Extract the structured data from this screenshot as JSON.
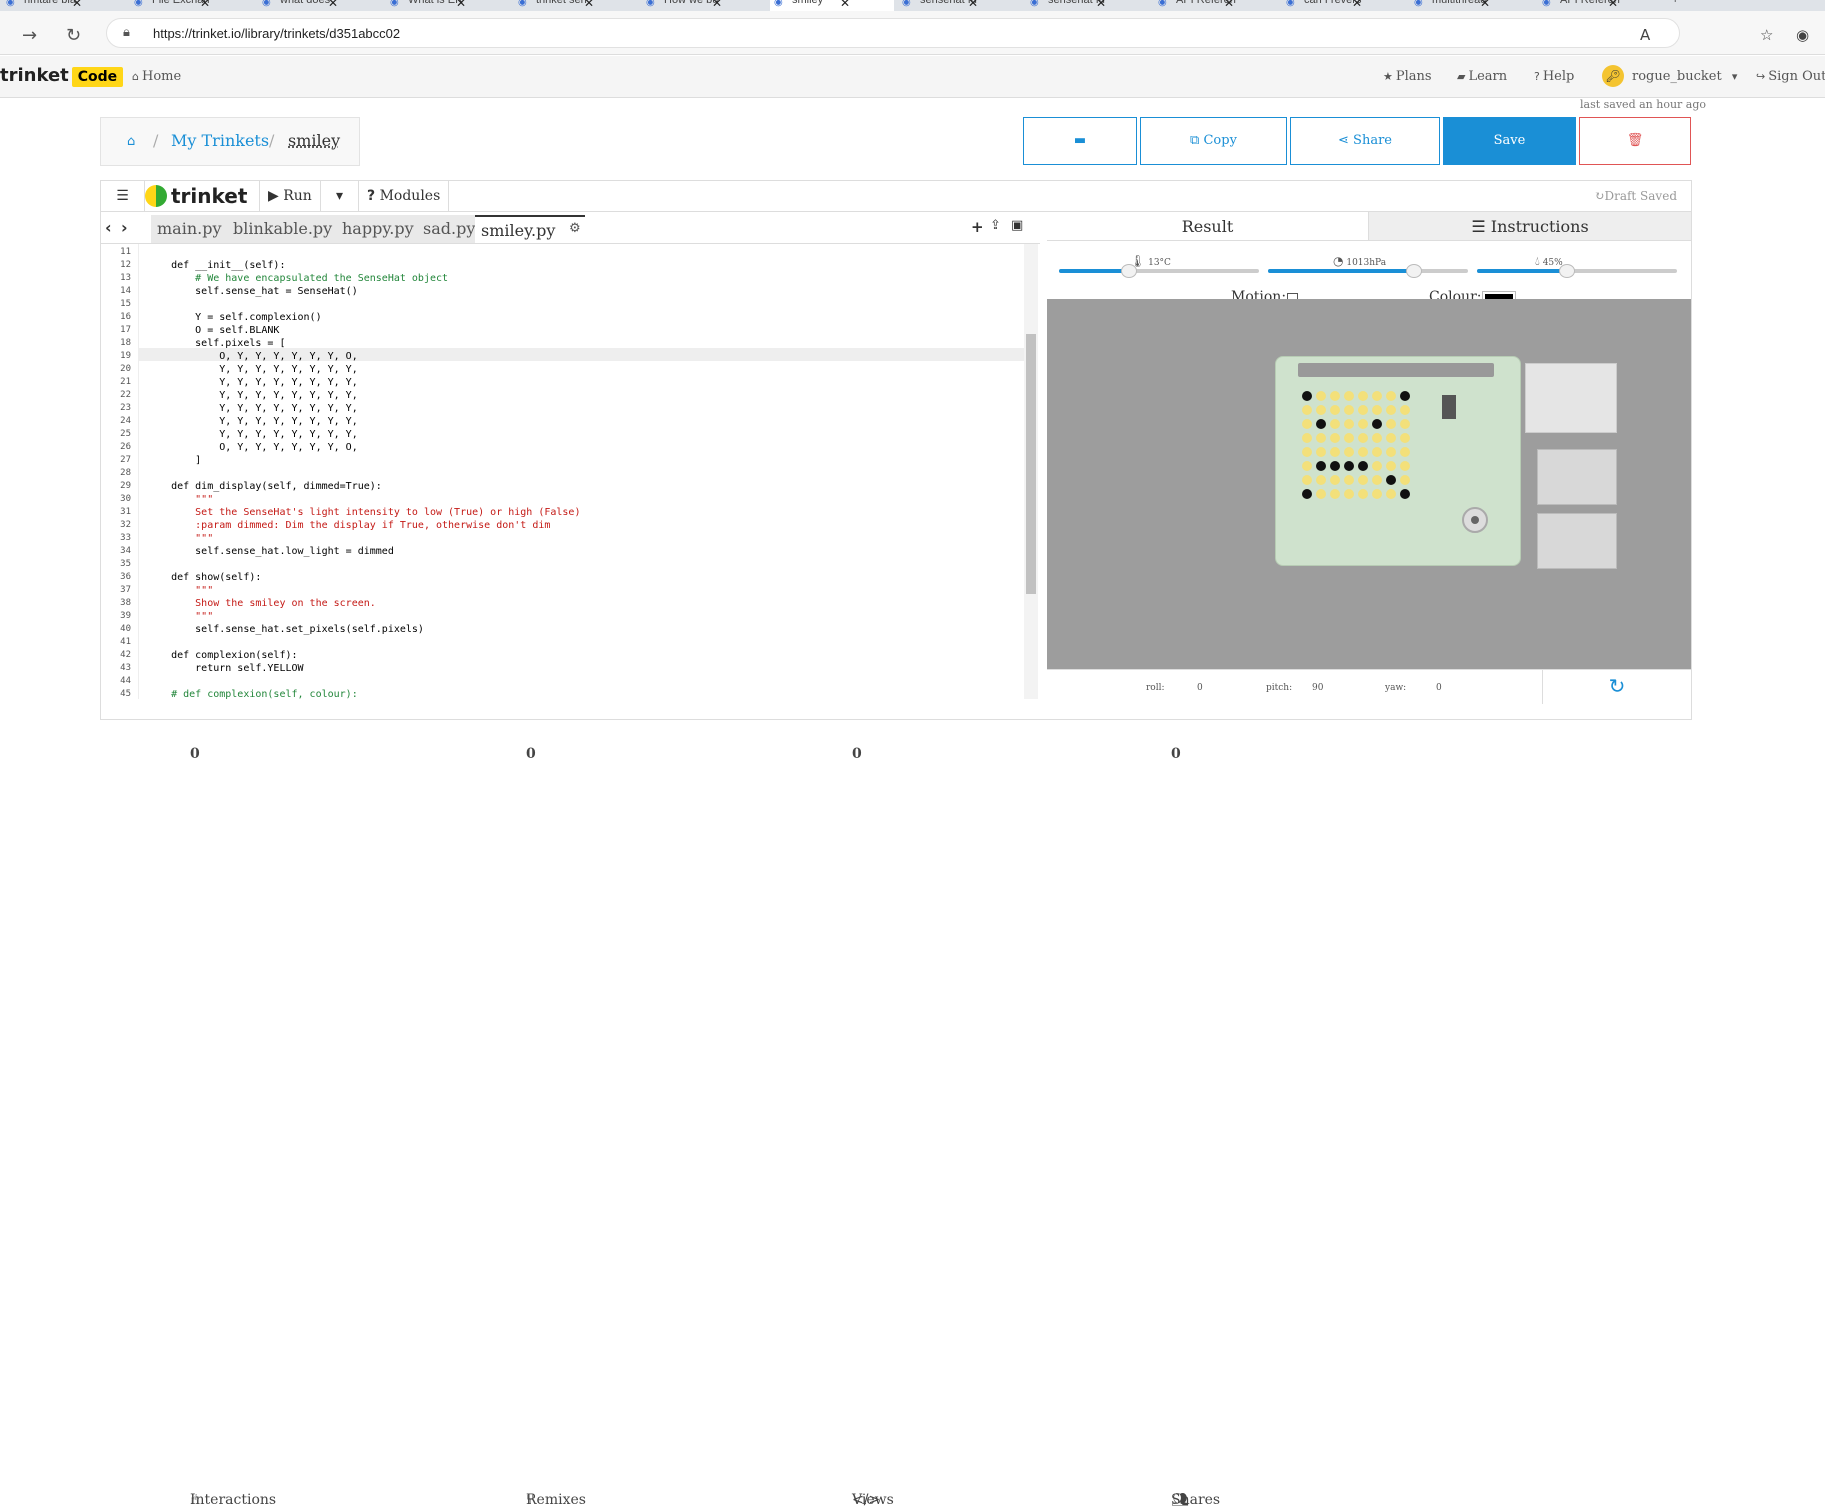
{
  "browser": {
    "tabs": [
      "hmtare bla",
      "File Exchan",
      "what does",
      "What is ER",
      "trinket sen",
      "How we bu",
      "smiley",
      "sensehat fu",
      "sensehat fu",
      "API Referen",
      "can I revers",
      "multithread",
      "API Referen"
    ],
    "active_tab": "smiley",
    "url": "https://trinket.io/library/trinkets/d351abcc02"
  },
  "site": {
    "logo": "trinket",
    "logo_badge": "Code",
    "home": "Home",
    "nav": [
      "Plans",
      "Learn",
      "Help"
    ],
    "user": "rogue_bucket",
    "sign_out": "Sign Out"
  },
  "breadcrumb": {
    "root": "My Trinkets",
    "current": "smiley"
  },
  "last_saved": "last saved an hour ago",
  "actions": {
    "copy": "Copy",
    "share": "Share",
    "save": "Save"
  },
  "toolbar": {
    "logo": "trinket",
    "run": "Run",
    "modules": "Modules",
    "draft": "Draft Saved"
  },
  "files": [
    "main.py",
    "blinkable.py",
    "happy.py",
    "sad.py",
    "smiley.py"
  ],
  "active_file": "smiley.py",
  "code": [
    {
      "n": "11",
      "t": ""
    },
    {
      "n": "12",
      "t": "    def __init__(self):"
    },
    {
      "n": "13",
      "t": "        # We have encapsulated the SenseHat object"
    },
    {
      "n": "14",
      "t": "        self.sense_hat = SenseHat()"
    },
    {
      "n": "15",
      "t": ""
    },
    {
      "n": "16",
      "t": "        Y = self.complexion()"
    },
    {
      "n": "17",
      "t": "        O = self.BLANK"
    },
    {
      "n": "18",
      "t": "        self.pixels = ["
    },
    {
      "n": "19",
      "t": "            O, Y, Y, Y, Y, Y, Y, O,"
    },
    {
      "n": "20",
      "t": "            Y, Y, Y, Y, Y, Y, Y, Y,"
    },
    {
      "n": "21",
      "t": "            Y, Y, Y, Y, Y, Y, Y, Y,"
    },
    {
      "n": "22",
      "t": "            Y, Y, Y, Y, Y, Y, Y, Y,"
    },
    {
      "n": "23",
      "t": "            Y, Y, Y, Y, Y, Y, Y, Y,"
    },
    {
      "n": "24",
      "t": "            Y, Y, Y, Y, Y, Y, Y, Y,"
    },
    {
      "n": "25",
      "t": "            Y, Y, Y, Y, Y, Y, Y, Y,"
    },
    {
      "n": "26",
      "t": "            O, Y, Y, Y, Y, Y, Y, O,"
    },
    {
      "n": "27",
      "t": "        ]"
    },
    {
      "n": "28",
      "t": ""
    },
    {
      "n": "29",
      "t": "    def dim_display(self, dimmed=True):"
    },
    {
      "n": "30",
      "t": "        \"\"\""
    },
    {
      "n": "31",
      "t": "        Set the SenseHat's light intensity to low (True) or high (False)"
    },
    {
      "n": "32",
      "t": "        :param dimmed: Dim the display if True, otherwise don't dim"
    },
    {
      "n": "33",
      "t": "        \"\"\""
    },
    {
      "n": "34",
      "t": "        self.sense_hat.low_light = dimmed"
    },
    {
      "n": "35",
      "t": ""
    },
    {
      "n": "36",
      "t": "    def show(self):"
    },
    {
      "n": "37",
      "t": "        \"\"\""
    },
    {
      "n": "38",
      "t": "        Show the smiley on the screen."
    },
    {
      "n": "39",
      "t": "        \"\"\""
    },
    {
      "n": "40",
      "t": "        self.sense_hat.set_pixels(self.pixels)"
    },
    {
      "n": "41",
      "t": ""
    },
    {
      "n": "42",
      "t": "    def complexion(self):"
    },
    {
      "n": "43",
      "t": "        return self.YELLOW"
    },
    {
      "n": "44",
      "t": ""
    },
    {
      "n": "45",
      "t": "    # def complexion(self, colour):"
    }
  ],
  "result": {
    "tab_result": "Result",
    "tab_instructions": "Instructions",
    "temperature": "13°C",
    "pressure": "1013hPa",
    "humidity": "45%",
    "motion_label": "Motion:",
    "colour_label": "Colour:",
    "roll_label": "roll:",
    "roll": "0",
    "pitch_label": "pitch:",
    "pitch": "90",
    "yaw_label": "yaw:",
    "yaw": "0",
    "sliders": {
      "temperature": 0.35,
      "pressure": 0.73,
      "humidity": 0.45
    }
  },
  "led_matrix": [
    "OYYYYYYO",
    "YYYYYYYY",
    "YOYYYOYY",
    "YYYYYYYY",
    "YYYYYYYY",
    "YOOOOYYY",
    "YYYYYYOY",
    "OYYYYYYO"
  ],
  "stats": {
    "interactions_label": "Interactions",
    "interactions": "0",
    "remixes_label": "Remixes",
    "remixes": "0",
    "views_label": "Views",
    "views": "0",
    "shares_label": "Shares",
    "shares": "0"
  },
  "colors": {
    "accent": "#1a8fd6",
    "save": "#1a8fd6",
    "led_on": "#f3e07a",
    "led_off": "#111111",
    "badge": "#ffd617"
  }
}
